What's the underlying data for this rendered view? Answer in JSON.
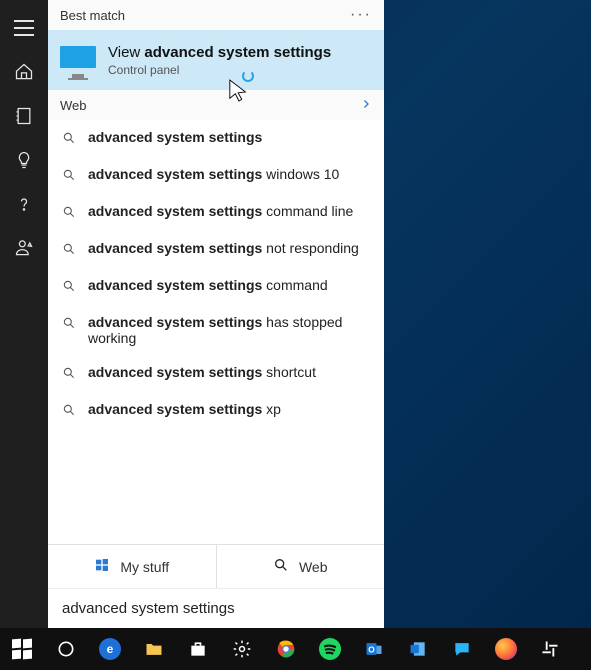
{
  "sidebar_rail": {
    "items": [
      {
        "name": "hamburger-menu-icon"
      },
      {
        "name": "home-icon"
      },
      {
        "name": "notebook-icon"
      },
      {
        "name": "suggestion-bulb-icon"
      },
      {
        "name": "help-question-icon"
      },
      {
        "name": "feedback-person-icon"
      }
    ]
  },
  "sections": {
    "best_match_header": "Best match",
    "web_header": "Web"
  },
  "best_match": {
    "title_prefix": "View ",
    "title_bold": "advanced system settings",
    "subtitle": "Control panel"
  },
  "web_results": [
    {
      "bold": "advanced system settings",
      "rest": ""
    },
    {
      "bold": "advanced system settings",
      "rest": " windows 10"
    },
    {
      "bold": "advanced system settings",
      "rest": " command line"
    },
    {
      "bold": "advanced system settings",
      "rest": " not responding"
    },
    {
      "bold": "advanced system settings",
      "rest": " command"
    },
    {
      "bold": "advanced system settings",
      "rest": " has stopped working"
    },
    {
      "bold": "advanced system settings",
      "rest": " shortcut"
    },
    {
      "bold": "advanced system settings",
      "rest": " xp"
    }
  ],
  "scope_bar": {
    "my_stuff": "My stuff",
    "web": "Web"
  },
  "search_input": {
    "value": "advanced system settings"
  },
  "taskbar": {
    "items": [
      {
        "name": "start-button"
      },
      {
        "name": "cortana-button"
      },
      {
        "name": "edge-browser"
      },
      {
        "name": "file-explorer"
      },
      {
        "name": "store"
      },
      {
        "name": "settings"
      },
      {
        "name": "chrome-browser"
      },
      {
        "name": "spotify"
      },
      {
        "name": "outlook"
      },
      {
        "name": "onenote"
      },
      {
        "name": "teams-chat"
      },
      {
        "name": "firefox-browser"
      },
      {
        "name": "slack"
      }
    ]
  },
  "colors": {
    "accent": "#cde8f6",
    "link": "#2a7ad4",
    "taskbar_bg": "#101010"
  }
}
